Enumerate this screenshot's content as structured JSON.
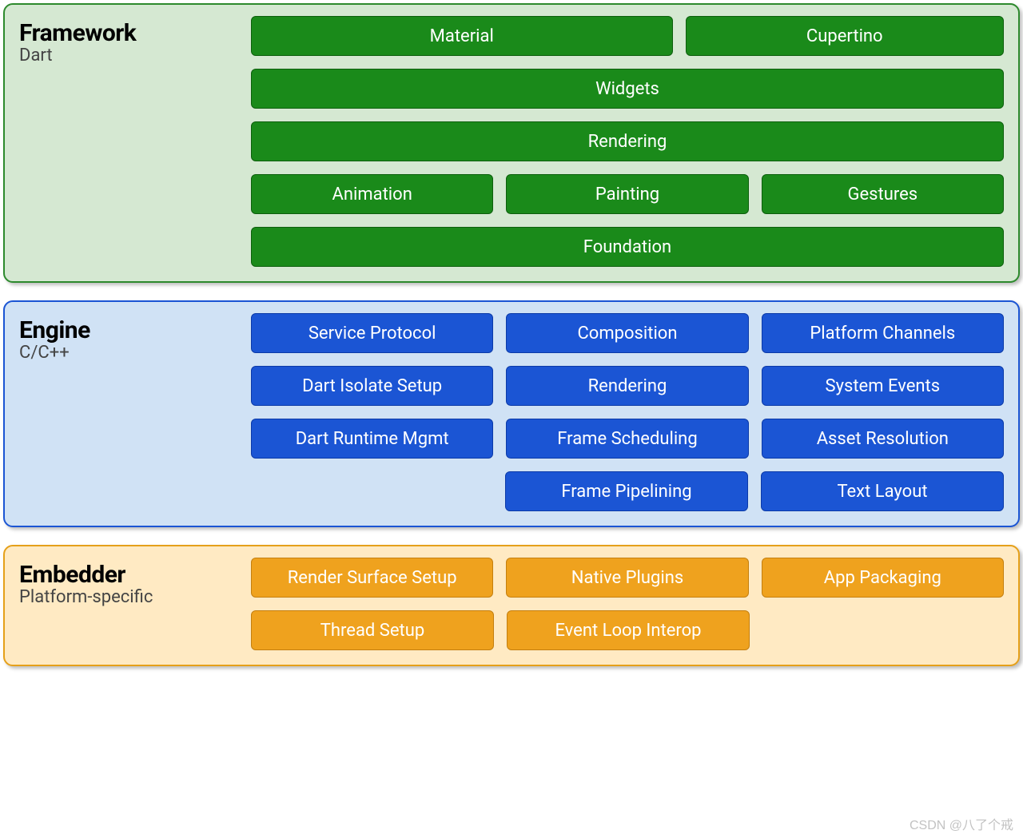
{
  "layers": {
    "framework": {
      "title": "Framework",
      "subtitle": "Dart",
      "row1": {
        "material": "Material",
        "cupertino": "Cupertino"
      },
      "row2": {
        "widgets": "Widgets"
      },
      "row3": {
        "rendering": "Rendering"
      },
      "row4": {
        "animation": "Animation",
        "painting": "Painting",
        "gestures": "Gestures"
      },
      "row5": {
        "foundation": "Foundation"
      }
    },
    "engine": {
      "title": "Engine",
      "subtitle": "C/C++",
      "row1": {
        "service_protocol": "Service Protocol",
        "composition": "Composition",
        "platform_channels": "Platform Channels"
      },
      "row2": {
        "dart_isolate_setup": "Dart Isolate Setup",
        "rendering": "Rendering",
        "system_events": "System Events"
      },
      "row3": {
        "dart_runtime_mgmt": "Dart Runtime Mgmt",
        "frame_scheduling": "Frame Scheduling",
        "asset_resolution": "Asset Resolution"
      },
      "row4": {
        "frame_pipelining": "Frame Pipelining",
        "text_layout": "Text Layout"
      }
    },
    "embedder": {
      "title": "Embedder",
      "subtitle": "Platform-specific",
      "row1": {
        "render_surface_setup": "Render Surface Setup",
        "native_plugins": "Native Plugins",
        "app_packaging": "App Packaging"
      },
      "row2": {
        "thread_setup": "Thread Setup",
        "event_loop_interop": "Event Loop Interop"
      }
    }
  },
  "watermark": "CSDN @八了个戒"
}
